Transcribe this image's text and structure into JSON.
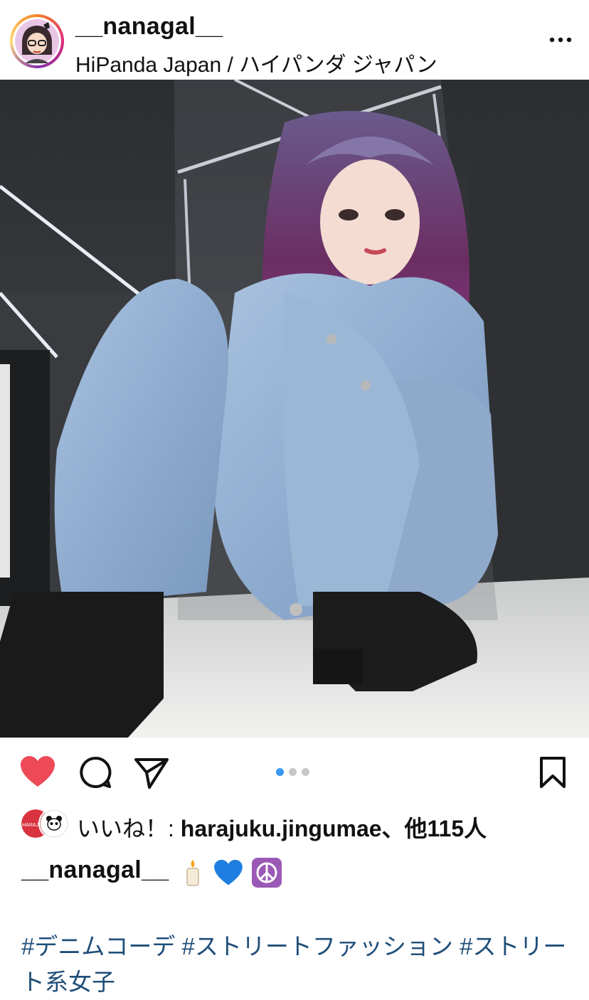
{
  "post": {
    "username": "__nanagal__",
    "location": "HiPanda Japan / ハイパンダ ジャパン"
  },
  "icons": {
    "more": "more-horizontal-icon",
    "like": "heart-filled-icon",
    "comment": "comment-icon",
    "share": "send-icon",
    "save": "bookmark-icon"
  },
  "colors": {
    "like_red": "#ed4956",
    "carousel_active": "#3897f0",
    "carousel_inactive": "#c7c7c7",
    "hashtag_blue": "#1f4e79",
    "text": "#111111"
  },
  "carousel": {
    "count": 3,
    "active_index": 0
  },
  "likes": {
    "prefix": "いいね！: ",
    "first_user": "harajuku.jingumae",
    "suffix": "、他115人"
  },
  "caption": {
    "username": "__nanagal__",
    "emojis": [
      "candle",
      "blue-heart",
      "peace-symbol"
    ]
  },
  "hashtags": [
    "#デニムコーデ",
    "#ストリートファッション",
    "#ストリート系女子"
  ]
}
